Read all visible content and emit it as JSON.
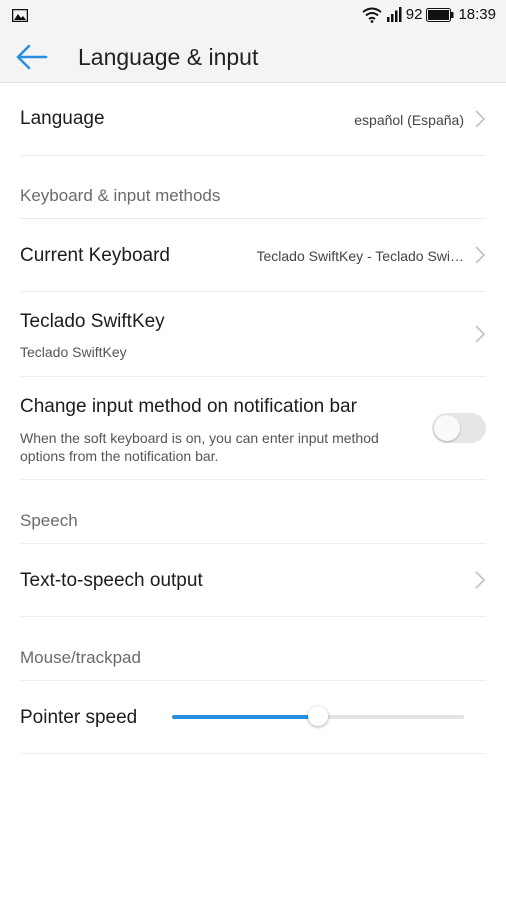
{
  "status_bar": {
    "signal_text": "92",
    "time": "18:39"
  },
  "app_bar": {
    "title": "Language & input"
  },
  "language": {
    "label": "Language",
    "value": "español (España)"
  },
  "sections": {
    "keyboard": "Keyboard & input methods",
    "speech": "Speech",
    "mouse": "Mouse/trackpad"
  },
  "current_keyboard": {
    "label": "Current Keyboard",
    "value": "Teclado SwiftKey - Teclado Swi…"
  },
  "swiftkey": {
    "label": "Teclado SwiftKey",
    "sub": "Teclado SwiftKey"
  },
  "notification_bar": {
    "label": "Change input method on notification bar",
    "description": "When the soft keyboard is on, you can enter input method options from the notification bar.",
    "enabled": false
  },
  "tts": {
    "label": "Text-to-speech output"
  },
  "pointer_speed": {
    "label": "Pointer speed",
    "level": 0.5
  },
  "colors": {
    "accent": "#2a8fe0"
  }
}
